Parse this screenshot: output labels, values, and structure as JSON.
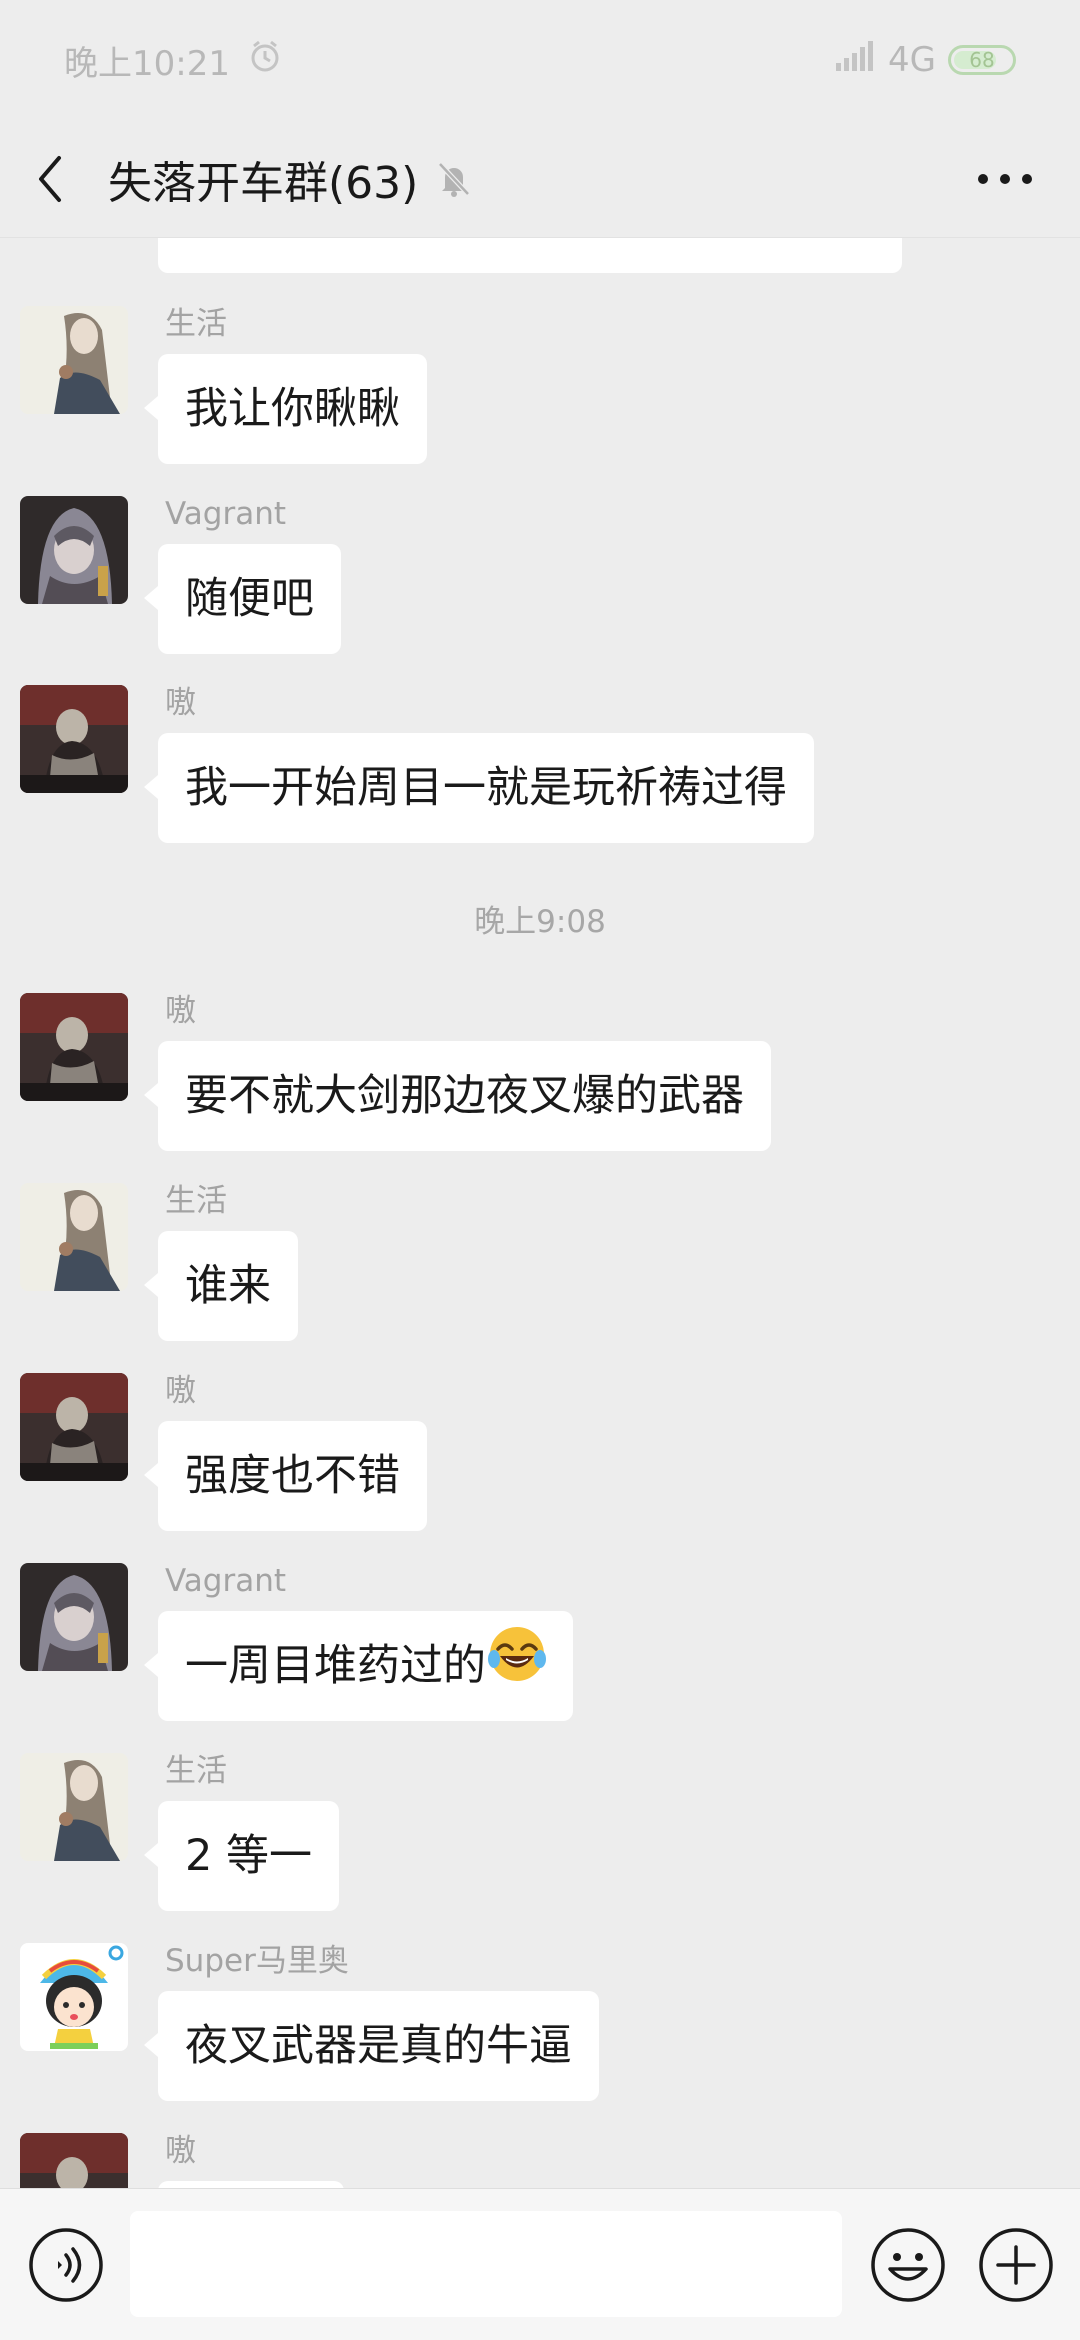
{
  "status_bar": {
    "time": "晚上10:21",
    "network": "4G",
    "battery": "68"
  },
  "nav": {
    "title": "失落开车群(63)",
    "icons": [
      "back-arrow-icon",
      "mute-bell-icon",
      "more-icon"
    ]
  },
  "messages": [
    {
      "sender": "生活",
      "text": "我让你瞅瞅",
      "avatar": "anime-girl-avatar"
    },
    {
      "sender": "Vagrant",
      "text": "随便吧",
      "avatar": "hooded-knight-avatar"
    },
    {
      "sender": "嗷",
      "text": "我一开始周目一就是玩祈祷过得",
      "avatar": "dark-warrior-avatar"
    },
    {
      "sender": "嗷",
      "text": "要不就大剑那边夜叉爆的武器",
      "avatar": "dark-warrior-avatar"
    },
    {
      "sender": "生活",
      "text": "谁来",
      "avatar": "anime-girl-avatar"
    },
    {
      "sender": "嗷",
      "text": "强度也不错",
      "avatar": "dark-warrior-avatar"
    },
    {
      "sender": "Vagrant",
      "text": "一周目堆药过的",
      "emoji": "😂",
      "avatar": "hooded-knight-avatar"
    },
    {
      "sender": "生活",
      "text": "2 等一",
      "avatar": "anime-girl-avatar"
    },
    {
      "sender": "Super马里奥",
      "text": "夜叉武器是真的牛逼",
      "avatar": "cartoon-girl-avatar"
    },
    {
      "sender": "嗷",
      "text": "",
      "avatar": "dark-warrior-avatar"
    }
  ],
  "timestamp": "晚上9:08",
  "input_bar": {
    "placeholder": "",
    "icons": [
      "voice-icon",
      "emoji-icon",
      "plus-icon"
    ]
  },
  "colors": {
    "background": "#ededed",
    "bubble": "#ffffff",
    "sender_text": "#a3a3a3",
    "battery": "#a3c493"
  }
}
